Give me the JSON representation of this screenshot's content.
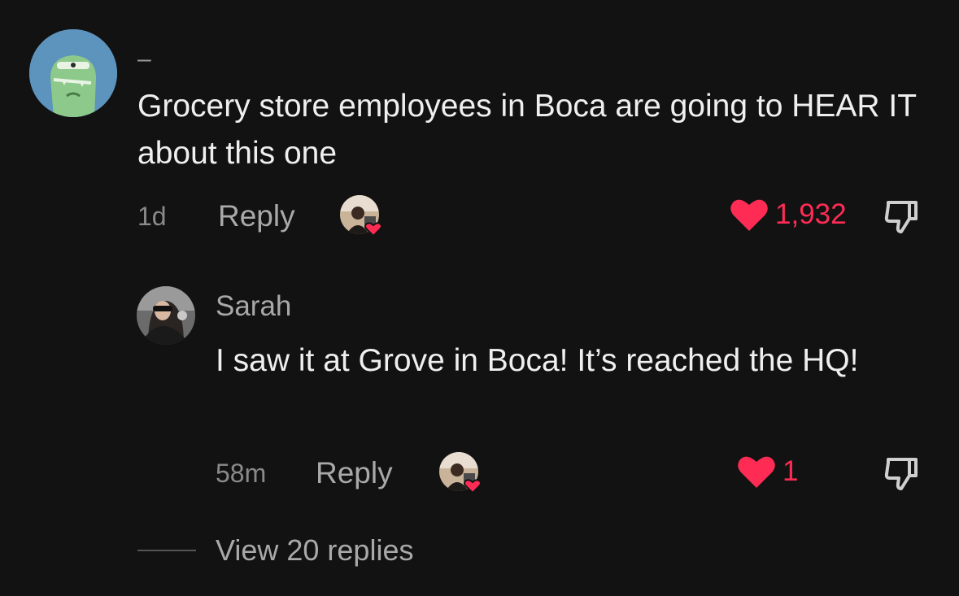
{
  "comments": [
    {
      "username": "–",
      "text": "Grocery store employees in Boca are going to HEAR IT about this one",
      "time": "1d",
      "reply_label": "Reply",
      "like_count": "1,932",
      "liked": true
    },
    {
      "username": "Sarah",
      "text": "I saw it at Grove in Boca! It’s reached the HQ!",
      "time": "58m",
      "reply_label": "Reply",
      "like_count": "1",
      "liked": true
    }
  ],
  "view_replies_label": "View 20 replies",
  "colors": {
    "background": "#121212",
    "like": "#fe2c55",
    "text": "#efefef",
    "muted": "#a9a9a9"
  },
  "icons": {
    "like": "heart-icon",
    "dislike": "thumbs-down-icon",
    "creator_liked": "creator-liked-badge"
  }
}
